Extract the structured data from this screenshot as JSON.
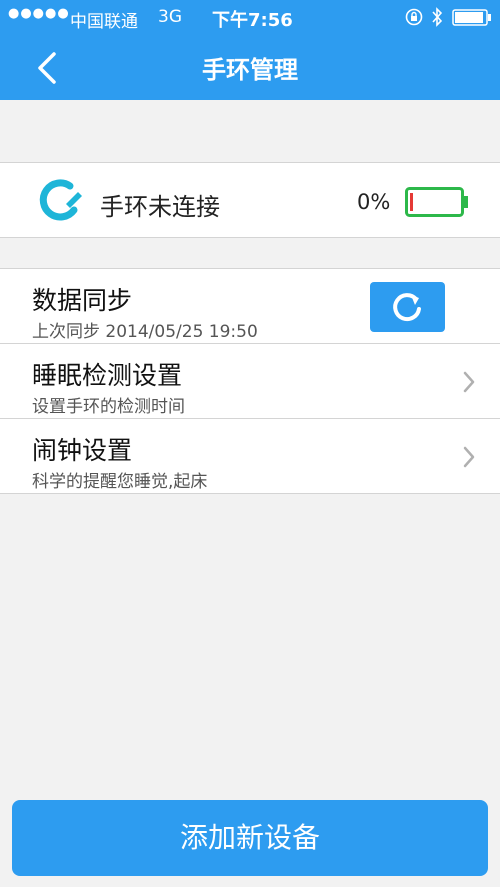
{
  "status_bar": {
    "signal": "●●●●●",
    "carrier": "中国联通",
    "network": "3G",
    "time": "下午7:56"
  },
  "nav": {
    "title": "手环管理",
    "back_icon": "chevron-left-icon"
  },
  "device": {
    "icon": "wristband-icon",
    "status": "手环未连接",
    "battery_percent": "0%",
    "battery_level": 0,
    "battery_color": "#2db84a",
    "battery_low_color": "#e53935"
  },
  "settings": {
    "items": [
      {
        "title": "数据同步",
        "subtitle": "上次同步 2014/05/25 19:50",
        "action_icon": "refresh-icon"
      },
      {
        "title": "睡眠检测设置",
        "subtitle": "设置手环的检测时间",
        "action_icon": "chevron-right-icon"
      },
      {
        "title": "闹钟设置",
        "subtitle": "科学的提醒您睡觉,起床",
        "action_icon": "chevron-right-icon"
      }
    ]
  },
  "footer": {
    "add_device_label": "添加新设备"
  },
  "colors": {
    "accent": "#2d9cf0",
    "background": "#f2f2f2",
    "divider": "#d4d4d4"
  }
}
